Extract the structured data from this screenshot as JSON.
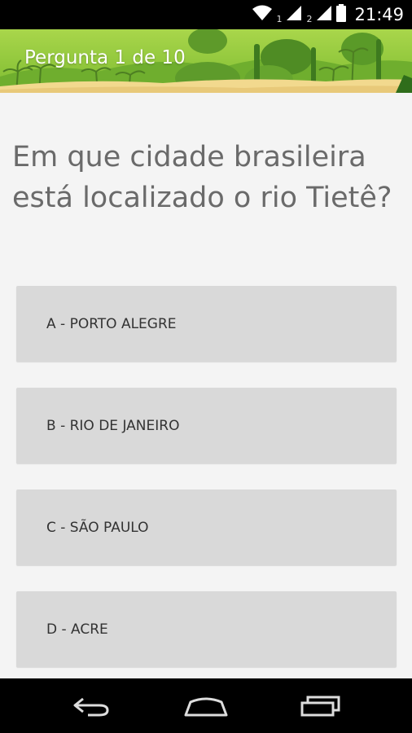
{
  "status_bar": {
    "sim1_label": "1",
    "sim2_label": "2",
    "time": "21:49",
    "icons": [
      "wifi-icon",
      "signal-icon",
      "signal-icon",
      "battery-icon"
    ]
  },
  "header": {
    "title": "Pergunta 1 de 10"
  },
  "question": {
    "text": "Em que cidade brasileira está localizado o rio Tietê?"
  },
  "answers": [
    {
      "label": "A - PORTO ALEGRE"
    },
    {
      "label": "B - RIO DE JANEIRO"
    },
    {
      "label": "C - SÃO PAULO"
    },
    {
      "label": "D - ACRE"
    }
  ],
  "nav_bar": {
    "icons": [
      "back-icon",
      "home-icon",
      "recent-apps-icon"
    ]
  },
  "colors": {
    "header_green": "#8fc63b",
    "answer_bg": "#d9d9d9",
    "page_bg": "#f4f4f4",
    "question_text": "#6a6a6a"
  }
}
